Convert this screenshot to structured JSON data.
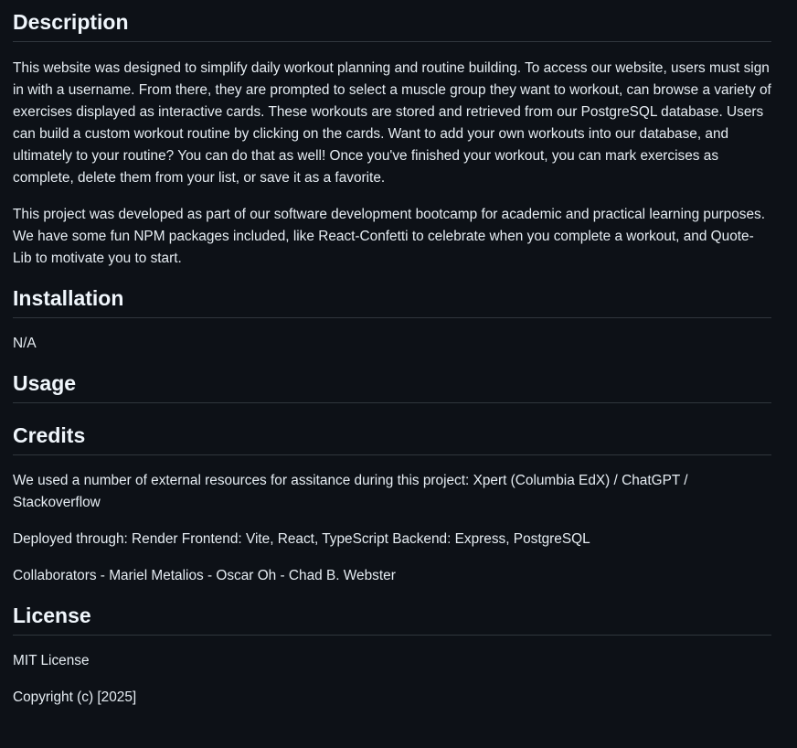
{
  "description": {
    "heading": "Description",
    "paragraph1": "This website was designed to simplify daily workout planning and routine building. To access our website, users must sign in with a username. From there, they are prompted to select a muscle group they want to workout, can browse a variety of exercises displayed as interactive cards. These workouts are stored and retrieved from our PostgreSQL database. Users can build a custom workout routine by clicking on the cards. Want to add your own workouts into our database, and ultimately to your routine? You can do that as well! Once you've finished your workout, you can mark exercises as complete, delete them from your list, or save it as a favorite.",
    "paragraph2": "This project was developed as part of our software development bootcamp for academic and practical learning purposes. We have some fun NPM packages included, like React-Confetti to celebrate when you complete a workout, and Quote-Lib to motivate you to start."
  },
  "installation": {
    "heading": "Installation",
    "text": "N/A"
  },
  "usage": {
    "heading": "Usage"
  },
  "credits": {
    "heading": "Credits",
    "resources": "We used a number of external resources for assitance during this project: Xpert (Columbia EdX) / ChatGPT / Stackoverflow",
    "deployed": "Deployed through: Render Frontend: Vite, React, TypeScript Backend: Express, PostgreSQL",
    "collaborators": "Collaborators - Mariel Metalios - Oscar Oh - Chad B. Webster"
  },
  "license": {
    "heading": "License",
    "name": "MIT License",
    "copyright": "Copyright (c) [2025]"
  }
}
